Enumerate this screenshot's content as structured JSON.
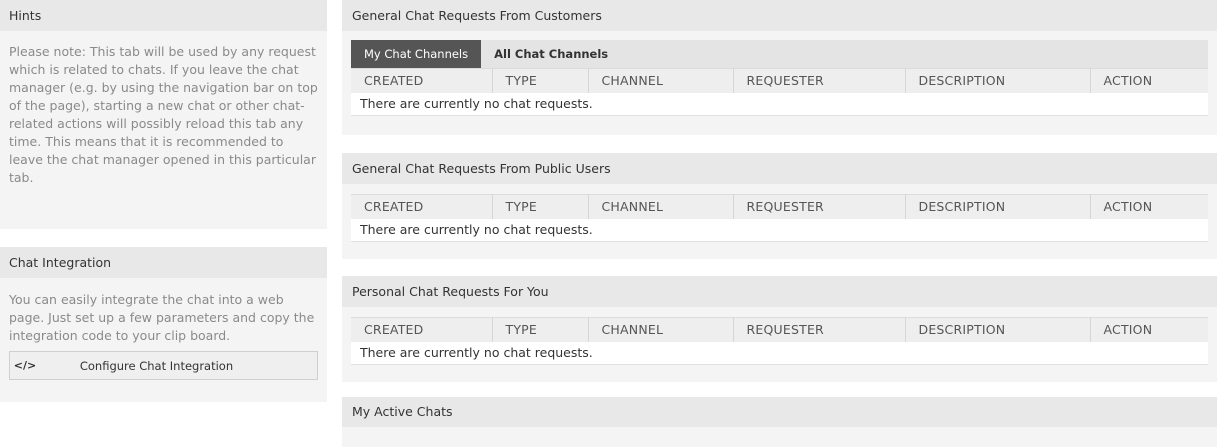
{
  "sidebar": {
    "hints": {
      "title": "Hints",
      "text": "Please note: This tab will be used by any request which is related to chats. If you leave the chat manager (e.g. by using the navigation bar on top of the page), starting a new chat or other chat-related actions will possibly reload this tab any time. This means that it is recommended to leave the chat manager opened in this particular tab."
    },
    "chat_integration": {
      "title": "Chat Integration",
      "text": "You can easily integrate the chat into a web page. Just set up a few parameters and copy the integration code to your clip board.",
      "button_icon": "</>",
      "button_label": "Configure Chat Integration"
    }
  },
  "columns": [
    "CREATED",
    "TYPE",
    "CHANNEL",
    "REQUESTER",
    "DESCRIPTION",
    "ACTION"
  ],
  "empty_message": "There are currently no chat requests.",
  "panels": {
    "customers": {
      "title": "General Chat Requests From Customers",
      "tabs": [
        "My Chat Channels",
        "All Chat Channels"
      ]
    },
    "public": {
      "title": "General Chat Requests From Public Users"
    },
    "personal": {
      "title": "Personal Chat Requests For You"
    },
    "active": {
      "title": "My Active Chats"
    }
  }
}
